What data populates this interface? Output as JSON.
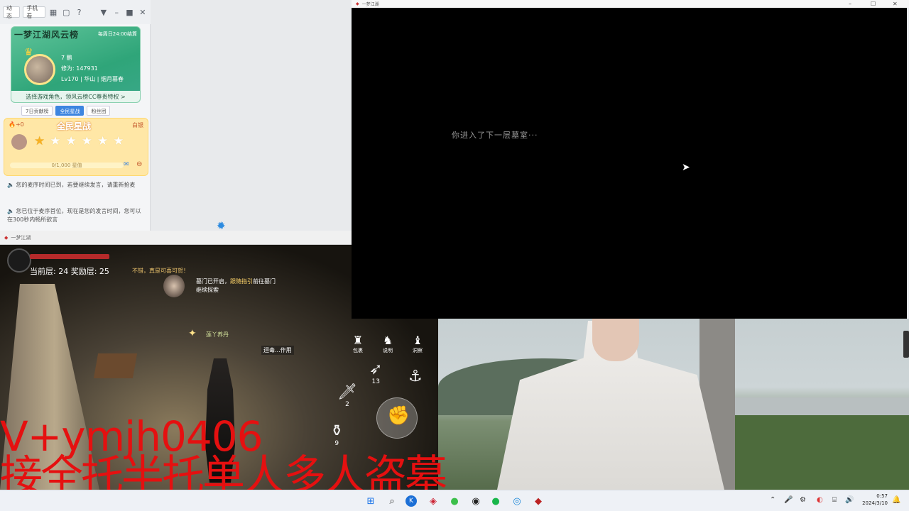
{
  "cc_panel": {
    "toolbar": {
      "btn1": "动态",
      "btn2": "手机看"
    },
    "rank_card": {
      "title": "一梦江湖风云榜",
      "deadline": "每周日24:00结算",
      "player_name": "7 鹏",
      "cultivation": "修为: 147931",
      "level_info": "Lv170 | 华山 | 烟月暮春",
      "cta": "选择游戏角色，领风云榜CC尊贵特权 >"
    },
    "tabs": [
      "7日贡献榜",
      "全民星战",
      "粉丝团"
    ],
    "star_card": {
      "title": "全民星战",
      "left_badge": "+0",
      "right_badge": "白银",
      "stars_filled": 1,
      "stars_total": 6,
      "progress_text": "0/1,000 星值"
    },
    "messages": [
      "您的麦序时间已到，若要继续发言，请重新抢麦",
      "您已位于麦序首位，现在是您的发言时间，您可以在300秒内畅所欲言"
    ]
  },
  "game_window": {
    "title": "一梦江湖",
    "floor_info": "当前层: 24  奖励层: 25",
    "floor_tip": "不错，真是可喜可贺！",
    "npc_line1": "墓门已开启，",
    "npc_link": "跟随指引",
    "npc_line1b": "前往墓门",
    "npc_line2": "继续探索",
    "pet_label": "莲丫养丹",
    "buff_label": "迴毒...作用",
    "buttons": [
      "包裹",
      "说明",
      "洞察"
    ],
    "skill_counts": {
      "dagger": "2",
      "bow": "13",
      "potion": "9"
    }
  },
  "dark_window": {
    "title": "一梦江湖",
    "message": "你进入了下一层墓室···"
  },
  "watermark": {
    "line1": "V+ymjh0406",
    "line2": "接全托半托单人多人盗墓"
  },
  "taskbar": {
    "icons": [
      "windows-start-icon",
      "search-icon",
      "k-app-icon",
      "cc-live-icon",
      "360-icon",
      "obs-icon",
      "wechat-icon",
      "edge-icon",
      "game-icon"
    ],
    "clock_time": "0:57",
    "clock_date": "2024/3/10"
  },
  "colors": {
    "watermark": "#e51010",
    "accent_blue": "#3d85e0",
    "rank_green": "#2fa579"
  }
}
